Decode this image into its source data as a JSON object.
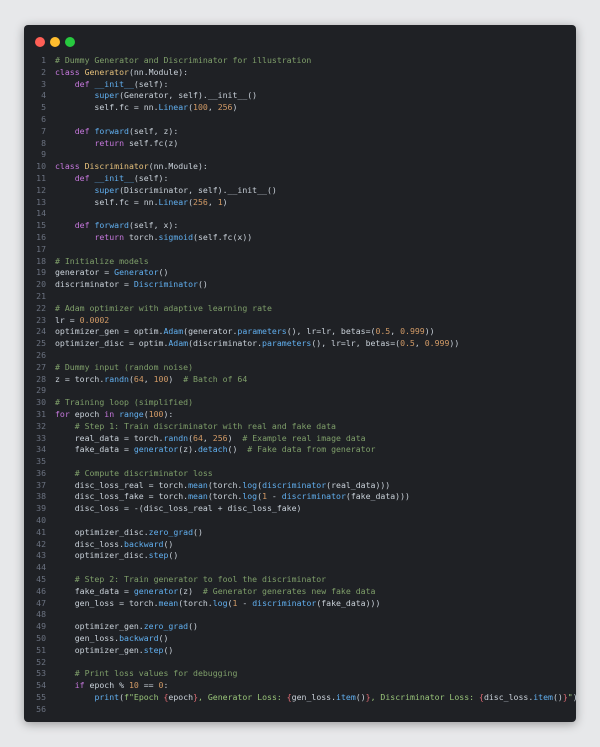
{
  "window": {
    "controls": [
      "close",
      "minimize",
      "maximize"
    ]
  },
  "code_lines": [
    [
      [
        "cm",
        "# Dummy Generator and Discriminator for illustration"
      ]
    ],
    [
      [
        "kw",
        "class "
      ],
      [
        "cls",
        "Generator"
      ],
      [
        "tx",
        "(nn.Module):"
      ]
    ],
    [
      [
        "tx",
        "    "
      ],
      [
        "kw",
        "def "
      ],
      [
        "fn",
        "__init__"
      ],
      [
        "tx",
        "(self):"
      ]
    ],
    [
      [
        "tx",
        "        "
      ],
      [
        "fn",
        "super"
      ],
      [
        "tx",
        "(Generator, self).__init__()"
      ]
    ],
    [
      [
        "tx",
        "        self.fc = nn."
      ],
      [
        "fn",
        "Linear"
      ],
      [
        "tx",
        "("
      ],
      [
        "num",
        "100"
      ],
      [
        "tx",
        ", "
      ],
      [
        "num",
        "256"
      ],
      [
        "tx",
        ")"
      ]
    ],
    [],
    [
      [
        "tx",
        "    "
      ],
      [
        "kw",
        "def "
      ],
      [
        "fn",
        "forward"
      ],
      [
        "tx",
        "(self, z):"
      ]
    ],
    [
      [
        "tx",
        "        "
      ],
      [
        "kw",
        "return "
      ],
      [
        "tx",
        "self.fc(z)"
      ]
    ],
    [],
    [
      [
        "kw",
        "class "
      ],
      [
        "cls",
        "Discriminator"
      ],
      [
        "tx",
        "(nn.Module):"
      ]
    ],
    [
      [
        "tx",
        "    "
      ],
      [
        "kw",
        "def "
      ],
      [
        "fn",
        "__init__"
      ],
      [
        "tx",
        "(self):"
      ]
    ],
    [
      [
        "tx",
        "        "
      ],
      [
        "fn",
        "super"
      ],
      [
        "tx",
        "(Discriminator, self).__init__()"
      ]
    ],
    [
      [
        "tx",
        "        self.fc = nn."
      ],
      [
        "fn",
        "Linear"
      ],
      [
        "tx",
        "("
      ],
      [
        "num",
        "256"
      ],
      [
        "tx",
        ", "
      ],
      [
        "num",
        "1"
      ],
      [
        "tx",
        ")"
      ]
    ],
    [],
    [
      [
        "tx",
        "    "
      ],
      [
        "kw",
        "def "
      ],
      [
        "fn",
        "forward"
      ],
      [
        "tx",
        "(self, x):"
      ]
    ],
    [
      [
        "tx",
        "        "
      ],
      [
        "kw",
        "return "
      ],
      [
        "tx",
        "torch."
      ],
      [
        "fn",
        "sigmoid"
      ],
      [
        "tx",
        "(self.fc(x))"
      ]
    ],
    [],
    [
      [
        "cm",
        "# Initialize models"
      ]
    ],
    [
      [
        "tx",
        "generator = "
      ],
      [
        "fn",
        "Generator"
      ],
      [
        "tx",
        "()"
      ]
    ],
    [
      [
        "tx",
        "discriminator = "
      ],
      [
        "fn",
        "Discriminator"
      ],
      [
        "tx",
        "()"
      ]
    ],
    [],
    [
      [
        "cm",
        "# Adam optimizer with adaptive learning rate"
      ]
    ],
    [
      [
        "tx",
        "lr = "
      ],
      [
        "num",
        "0.0002"
      ]
    ],
    [
      [
        "tx",
        "optimizer_gen = optim."
      ],
      [
        "fn",
        "Adam"
      ],
      [
        "tx",
        "(generator."
      ],
      [
        "fn",
        "parameters"
      ],
      [
        "tx",
        "(), lr=lr, betas=("
      ],
      [
        "num",
        "0.5"
      ],
      [
        "tx",
        ", "
      ],
      [
        "num",
        "0.999"
      ],
      [
        "tx",
        "))"
      ]
    ],
    [
      [
        "tx",
        "optimizer_disc = optim."
      ],
      [
        "fn",
        "Adam"
      ],
      [
        "tx",
        "(discriminator."
      ],
      [
        "fn",
        "parameters"
      ],
      [
        "tx",
        "(), lr=lr, betas=("
      ],
      [
        "num",
        "0.5"
      ],
      [
        "tx",
        ", "
      ],
      [
        "num",
        "0.999"
      ],
      [
        "tx",
        "))"
      ]
    ],
    [],
    [
      [
        "cm",
        "# Dummy input (random noise)"
      ]
    ],
    [
      [
        "tx",
        "z = torch."
      ],
      [
        "fn",
        "randn"
      ],
      [
        "tx",
        "("
      ],
      [
        "num",
        "64"
      ],
      [
        "tx",
        ", "
      ],
      [
        "num",
        "100"
      ],
      [
        "tx",
        ")  "
      ],
      [
        "cm",
        "# Batch of 64"
      ]
    ],
    [],
    [
      [
        "cm",
        "# Training loop (simplified)"
      ]
    ],
    [
      [
        "kw",
        "for "
      ],
      [
        "tx",
        "epoch "
      ],
      [
        "kw",
        "in "
      ],
      [
        "fn",
        "range"
      ],
      [
        "tx",
        "("
      ],
      [
        "num",
        "100"
      ],
      [
        "tx",
        "):"
      ]
    ],
    [
      [
        "tx",
        "    "
      ],
      [
        "cm",
        "# Step 1: Train discriminator with real and fake data"
      ]
    ],
    [
      [
        "tx",
        "    real_data = torch."
      ],
      [
        "fn",
        "randn"
      ],
      [
        "tx",
        "("
      ],
      [
        "num",
        "64"
      ],
      [
        "tx",
        ", "
      ],
      [
        "num",
        "256"
      ],
      [
        "tx",
        ")  "
      ],
      [
        "cm",
        "# Example real image data"
      ]
    ],
    [
      [
        "tx",
        "    fake_data = "
      ],
      [
        "fn",
        "generator"
      ],
      [
        "tx",
        "(z)."
      ],
      [
        "fn",
        "detach"
      ],
      [
        "tx",
        "()  "
      ],
      [
        "cm",
        "# Fake data from generator"
      ]
    ],
    [],
    [
      [
        "tx",
        "    "
      ],
      [
        "cm",
        "# Compute discriminator loss"
      ]
    ],
    [
      [
        "tx",
        "    disc_loss_real = torch."
      ],
      [
        "fn",
        "mean"
      ],
      [
        "tx",
        "(torch."
      ],
      [
        "fn",
        "log"
      ],
      [
        "tx",
        "("
      ],
      [
        "fn",
        "discriminator"
      ],
      [
        "tx",
        "(real_data)))"
      ]
    ],
    [
      [
        "tx",
        "    disc_loss_fake = torch."
      ],
      [
        "fn",
        "mean"
      ],
      [
        "tx",
        "(torch."
      ],
      [
        "fn",
        "log"
      ],
      [
        "tx",
        "("
      ],
      [
        "num",
        "1"
      ],
      [
        "tx",
        " - "
      ],
      [
        "fn",
        "discriminator"
      ],
      [
        "tx",
        "(fake_data)))"
      ]
    ],
    [
      [
        "tx",
        "    disc_loss = -(disc_loss_real + disc_loss_fake)"
      ]
    ],
    [],
    [
      [
        "tx",
        "    optimizer_disc."
      ],
      [
        "fn",
        "zero_grad"
      ],
      [
        "tx",
        "()"
      ]
    ],
    [
      [
        "tx",
        "    disc_loss."
      ],
      [
        "fn",
        "backward"
      ],
      [
        "tx",
        "()"
      ]
    ],
    [
      [
        "tx",
        "    optimizer_disc."
      ],
      [
        "fn",
        "step"
      ],
      [
        "tx",
        "()"
      ]
    ],
    [],
    [
      [
        "tx",
        "    "
      ],
      [
        "cm",
        "# Step 2: Train generator to fool the discriminator"
      ]
    ],
    [
      [
        "tx",
        "    fake_data = "
      ],
      [
        "fn",
        "generator"
      ],
      [
        "tx",
        "(z)  "
      ],
      [
        "cm",
        "# Generator generates new fake data"
      ]
    ],
    [
      [
        "tx",
        "    gen_loss = torch."
      ],
      [
        "fn",
        "mean"
      ],
      [
        "tx",
        "(torch."
      ],
      [
        "fn",
        "log"
      ],
      [
        "tx",
        "("
      ],
      [
        "num",
        "1"
      ],
      [
        "tx",
        " - "
      ],
      [
        "fn",
        "discriminator"
      ],
      [
        "tx",
        "(fake_data)))"
      ]
    ],
    [],
    [
      [
        "tx",
        "    optimizer_gen."
      ],
      [
        "fn",
        "zero_grad"
      ],
      [
        "tx",
        "()"
      ]
    ],
    [
      [
        "tx",
        "    gen_loss."
      ],
      [
        "fn",
        "backward"
      ],
      [
        "tx",
        "()"
      ]
    ],
    [
      [
        "tx",
        "    optimizer_gen."
      ],
      [
        "fn",
        "step"
      ],
      [
        "tx",
        "()"
      ]
    ],
    [],
    [
      [
        "tx",
        "    "
      ],
      [
        "cm",
        "# Print loss values for debugging"
      ]
    ],
    [
      [
        "tx",
        "    "
      ],
      [
        "kw",
        "if "
      ],
      [
        "tx",
        "epoch % "
      ],
      [
        "num",
        "10"
      ],
      [
        "tx",
        " == "
      ],
      [
        "num",
        "0"
      ],
      [
        "tx",
        ":"
      ]
    ],
    [
      [
        "tx",
        "        "
      ],
      [
        "fn",
        "print"
      ],
      [
        "tx",
        "("
      ],
      [
        "str",
        "f\"Epoch "
      ],
      [
        "br",
        "{"
      ],
      [
        "tx",
        "epoch"
      ],
      [
        "br",
        "}"
      ],
      [
        "str",
        ", Generator Loss: "
      ],
      [
        "br",
        "{"
      ],
      [
        "tx",
        "gen_loss."
      ],
      [
        "fn",
        "item"
      ],
      [
        "tx",
        "()"
      ],
      [
        "br",
        "}"
      ],
      [
        "str",
        ", Discriminator Loss: "
      ],
      [
        "br",
        "{"
      ],
      [
        "tx",
        "disc_loss."
      ],
      [
        "fn",
        "item"
      ],
      [
        "tx",
        "()"
      ],
      [
        "br",
        "}"
      ],
      [
        "str",
        "\""
      ],
      [
        "tx",
        ")"
      ]
    ],
    []
  ]
}
